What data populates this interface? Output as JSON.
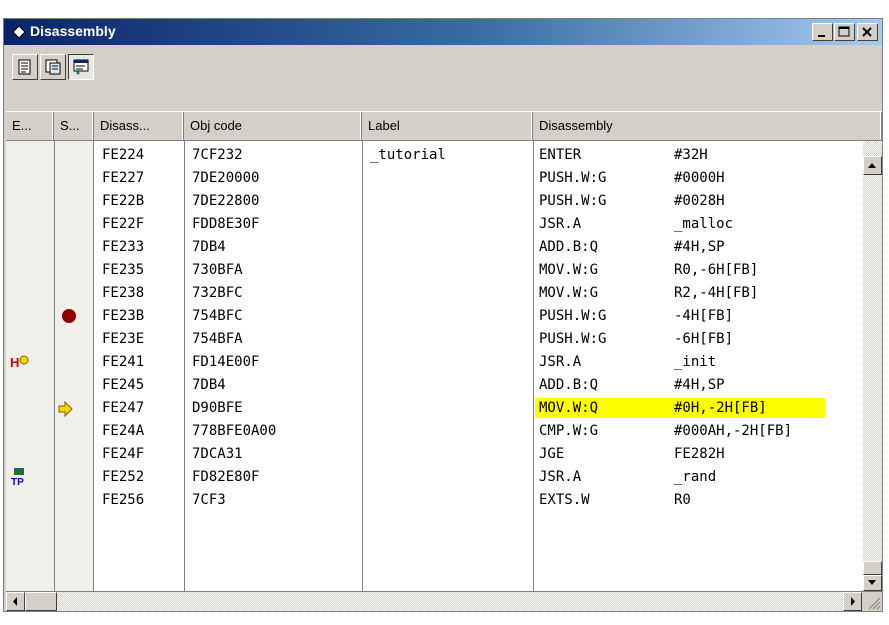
{
  "window": {
    "title": "Disassembly"
  },
  "columns": [
    "E...",
    "S...",
    "Disass...",
    "Obj code",
    "Label",
    "Disassembly"
  ],
  "rows": [
    {
      "addr": "FE224",
      "obj": "7CF232",
      "label": "_tutorial",
      "mnem": "ENTER",
      "operand": "#32H",
      "event": "",
      "status": ""
    },
    {
      "addr": "FE227",
      "obj": "7DE20000",
      "label": "",
      "mnem": "PUSH.W:G",
      "operand": "#0000H",
      "event": "",
      "status": ""
    },
    {
      "addr": "FE22B",
      "obj": "7DE22800",
      "label": "",
      "mnem": "PUSH.W:G",
      "operand": "#0028H",
      "event": "",
      "status": ""
    },
    {
      "addr": "FE22F",
      "obj": "FDD8E30F",
      "label": "",
      "mnem": "JSR.A",
      "operand": "_malloc",
      "event": "",
      "status": ""
    },
    {
      "addr": "FE233",
      "obj": "7DB4",
      "label": "",
      "mnem": "ADD.B:Q",
      "operand": "#4H,SP",
      "event": "",
      "status": ""
    },
    {
      "addr": "FE235",
      "obj": "730BFA",
      "label": "",
      "mnem": "MOV.W:G",
      "operand": "R0,-6H[FB]",
      "event": "",
      "status": ""
    },
    {
      "addr": "FE238",
      "obj": "732BFC",
      "label": "",
      "mnem": "MOV.W:G",
      "operand": "R2,-4H[FB]",
      "event": "",
      "status": ""
    },
    {
      "addr": "FE23B",
      "obj": "754BFC",
      "label": "",
      "mnem": "PUSH.W:G",
      "operand": "-4H[FB]",
      "event": "",
      "status": "breakpoint"
    },
    {
      "addr": "FE23E",
      "obj": "754BFA",
      "label": "",
      "mnem": "PUSH.W:G",
      "operand": "-6H[FB]",
      "event": "",
      "status": ""
    },
    {
      "addr": "FE241",
      "obj": "FD14E00F",
      "label": "",
      "mnem": "JSR.A",
      "operand": "_init",
      "event": "hardware-break",
      "status": ""
    },
    {
      "addr": "FE245",
      "obj": "7DB4",
      "label": "",
      "mnem": "ADD.B:Q",
      "operand": "#4H,SP",
      "event": "",
      "status": ""
    },
    {
      "addr": "FE247",
      "obj": "D90BFE",
      "label": "",
      "mnem": "MOV.W:Q",
      "operand": "#0H,-2H[FB]",
      "event": "",
      "status": "current",
      "highlight": true
    },
    {
      "addr": "FE24A",
      "obj": "778BFE0A00",
      "label": "",
      "mnem": "CMP.W:G",
      "operand": "#000AH,-2H[FB]",
      "event": "",
      "status": ""
    },
    {
      "addr": "FE24F",
      "obj": "7DCA31",
      "label": "",
      "mnem": "JGE",
      "operand": "FE282H",
      "event": "",
      "status": ""
    },
    {
      "addr": "FE252",
      "obj": "FD82E80F",
      "label": "",
      "mnem": "JSR.A",
      "operand": "_rand",
      "event": "trace-point",
      "status": ""
    },
    {
      "addr": "FE256",
      "obj": "7CF3",
      "label": "",
      "mnem": "EXTS.W",
      "operand": "R0",
      "event": "",
      "status": ""
    }
  ],
  "toolbar": {
    "buttons": [
      "text-view",
      "mixed-view",
      "disassembly-view"
    ]
  },
  "colors": {
    "highlight": "#ffff00",
    "breakpoint": "#8b0000",
    "arrow": "#ffd700",
    "title_start": "#0a246a",
    "title_end": "#a6caf0"
  }
}
